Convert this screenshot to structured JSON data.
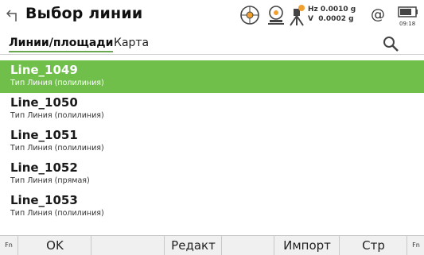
{
  "header": {
    "title": "Выбор линии",
    "hz_line": "Hz 0.0010 g",
    "v_line": "V  0.0002 g",
    "at_symbol": "@",
    "battery_time": "09:18"
  },
  "tabs": [
    {
      "label": "Линии/площади",
      "active": true
    },
    {
      "label": "Карта",
      "active": false
    }
  ],
  "list": [
    {
      "name": "Line_1049",
      "type": "Тип  Линия (полилиния)",
      "selected": true
    },
    {
      "name": "Line_1050",
      "type": "Тип  Линия (полилиния)",
      "selected": false
    },
    {
      "name": "Line_1051",
      "type": "Тип  Линия (полилиния)",
      "selected": false
    },
    {
      "name": "Line_1052",
      "type": "Тип  Линия (прямая)",
      "selected": false
    },
    {
      "name": "Line_1053",
      "type": "Тип  Линия (полилиния)",
      "selected": false
    }
  ],
  "softkeys": {
    "fn_left": "Fn",
    "fn_right": "Fn",
    "keys": [
      "OK",
      "",
      "Редакт",
      "",
      "Импорт",
      "Стр"
    ]
  },
  "colors": {
    "selection": "#6fbf4a",
    "tab_underline": "#6aa84f"
  }
}
